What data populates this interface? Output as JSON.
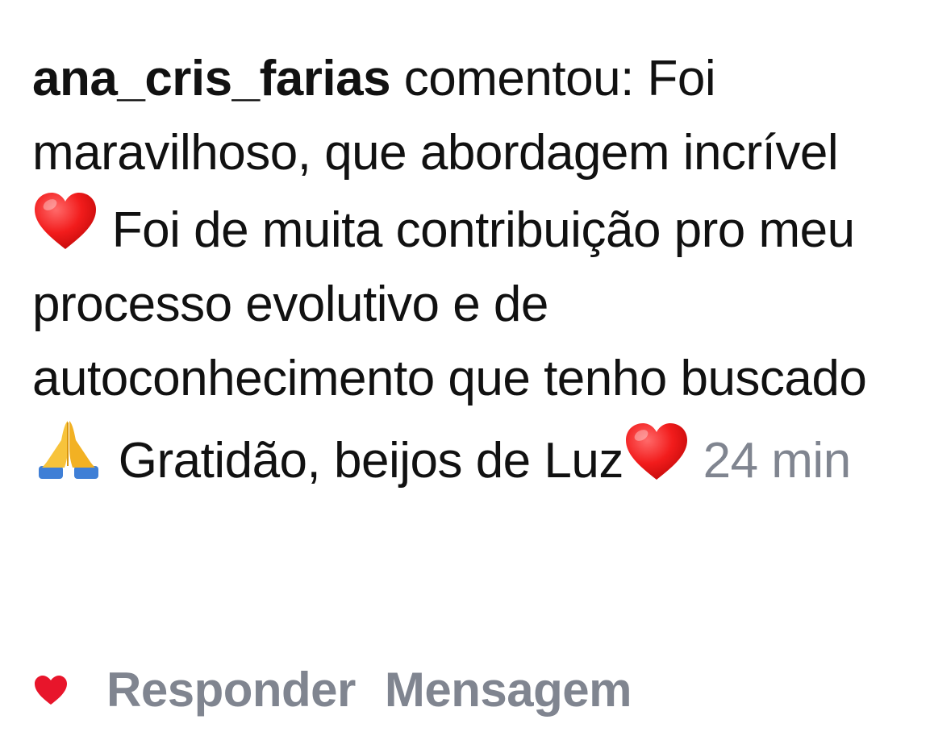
{
  "comment": {
    "username": "ana_cris_farias",
    "verb": "comentou:",
    "text_part1": "Foi maravilhoso, que abordagem incrível",
    "text_part2": "Foi de muita contribuição pro meu processo evolutivo e de autoconhecimento que tenho buscado",
    "text_part3": "Gratidão, beijos de Luz",
    "time": "24 min",
    "icons": {
      "heart_emoji_1": "red-heart-emoji",
      "pray_emoji": "folded-hands-emoji",
      "heart_emoji_2": "red-heart-emoji"
    }
  },
  "actions": {
    "like_icon": "heart-icon",
    "reply_label": "Responder",
    "message_label": "Mensagem"
  },
  "colors": {
    "text": "#111111",
    "muted": "#808590",
    "heart": "#e8152b",
    "background": "#ffffff"
  }
}
